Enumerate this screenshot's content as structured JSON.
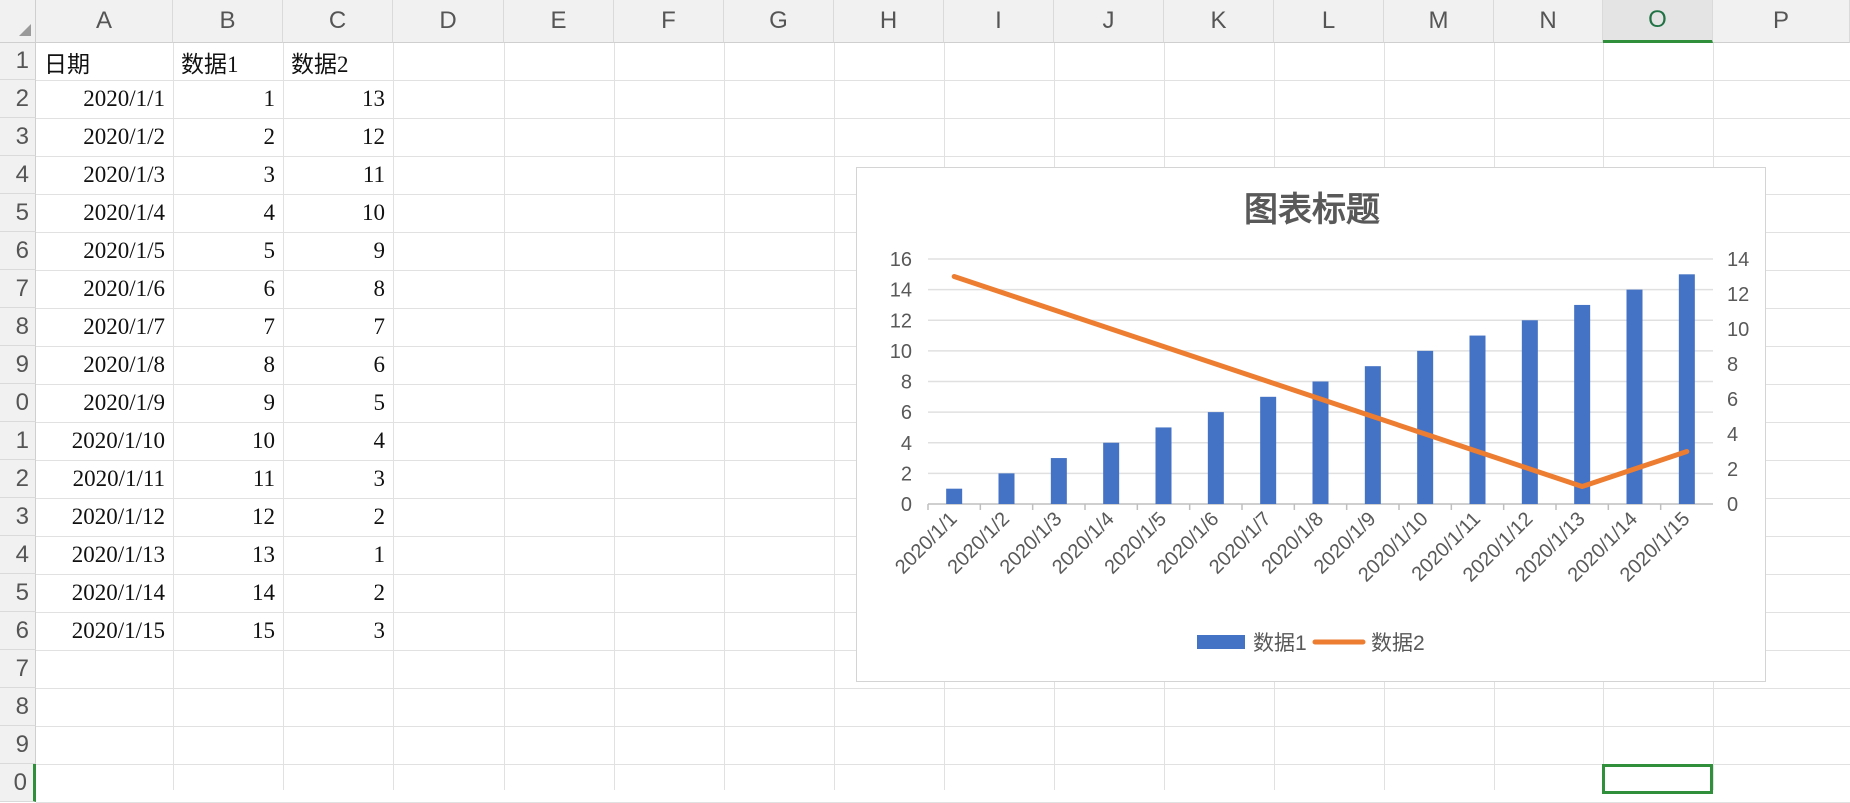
{
  "columns": [
    "A",
    "B",
    "C",
    "D",
    "E",
    "F",
    "G",
    "H",
    "I",
    "J",
    "K",
    "L",
    "M",
    "N",
    "O",
    "P"
  ],
  "rows": [
    "1",
    "2",
    "3",
    "4",
    "5",
    "6",
    "7",
    "8",
    "9",
    "0",
    "1",
    "2",
    "3",
    "4",
    "5",
    "6",
    "7",
    "8",
    "9",
    "0"
  ],
  "selected_column": "O",
  "table": {
    "headers": [
      "日期",
      "数据1",
      "数据2"
    ],
    "rows": [
      [
        "2020/1/1",
        "1",
        "13"
      ],
      [
        "2020/1/2",
        "2",
        "12"
      ],
      [
        "2020/1/3",
        "3",
        "11"
      ],
      [
        "2020/1/4",
        "4",
        "10"
      ],
      [
        "2020/1/5",
        "5",
        "9"
      ],
      [
        "2020/1/6",
        "6",
        "8"
      ],
      [
        "2020/1/7",
        "7",
        "7"
      ],
      [
        "2020/1/8",
        "8",
        "6"
      ],
      [
        "2020/1/9",
        "9",
        "5"
      ],
      [
        "2020/1/10",
        "10",
        "4"
      ],
      [
        "2020/1/11",
        "11",
        "3"
      ],
      [
        "2020/1/12",
        "12",
        "2"
      ],
      [
        "2020/1/13",
        "13",
        "1"
      ],
      [
        "2020/1/14",
        "14",
        "2"
      ],
      [
        "2020/1/15",
        "15",
        "3"
      ]
    ]
  },
  "colors": {
    "bar": "#4472c4",
    "line": "#ed7d31",
    "selection": "#2f8f3a"
  },
  "chart_data": {
    "type": "bar",
    "title": "图表标题",
    "categories": [
      "2020/1/1",
      "2020/1/2",
      "2020/1/3",
      "2020/1/4",
      "2020/1/5",
      "2020/1/6",
      "2020/1/7",
      "2020/1/8",
      "2020/1/9",
      "2020/1/10",
      "2020/1/11",
      "2020/1/12",
      "2020/1/13",
      "2020/1/14",
      "2020/1/15"
    ],
    "series": [
      {
        "name": "数据1",
        "type": "bar",
        "axis": "left",
        "values": [
          1,
          2,
          3,
          4,
          5,
          6,
          7,
          8,
          9,
          10,
          11,
          12,
          13,
          14,
          15
        ]
      },
      {
        "name": "数据2",
        "type": "line",
        "axis": "right",
        "values": [
          13,
          12,
          11,
          10,
          9,
          8,
          7,
          6,
          5,
          4,
          3,
          2,
          1,
          2,
          3
        ]
      }
    ],
    "ylim": [
      0,
      16
    ],
    "yticks": [
      "0",
      "2",
      "4",
      "6",
      "8",
      "10",
      "12",
      "14",
      "16"
    ],
    "y2lim": [
      0,
      14
    ],
    "y2ticks": [
      "0",
      "2",
      "4",
      "6",
      "8",
      "10",
      "12",
      "14"
    ],
    "grid": true,
    "legend": "bottom"
  }
}
